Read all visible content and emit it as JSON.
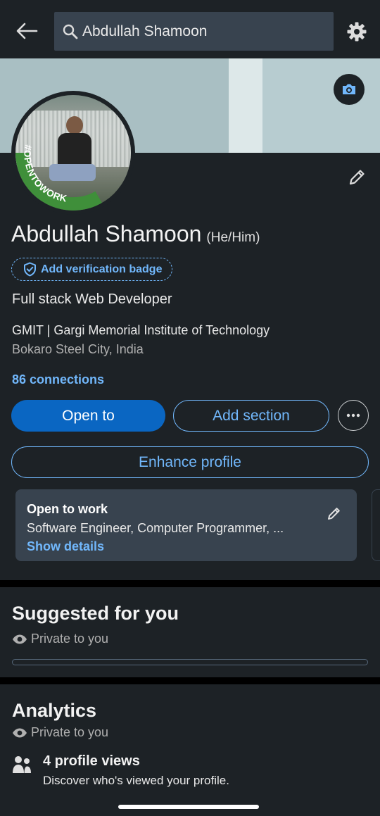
{
  "search": {
    "query": "Abdullah Shamoon"
  },
  "profile": {
    "name": "Abdullah Shamoon",
    "pronouns": "(He/Him)",
    "verification_label": "Add verification badge",
    "open_to_work_frame": "#OPENTOWORK",
    "headline": "Full stack Web Developer",
    "education": "GMIT | Gargi Memorial Institute of Technology",
    "location": "Bokaro Steel City, India",
    "connections": "86 connections"
  },
  "actions": {
    "open_to": "Open to",
    "add_section": "Add section",
    "enhance": "Enhance profile"
  },
  "open_to_work": {
    "title": "Open to work",
    "roles": "Software Engineer, Computer Programmer, ...",
    "show_details": "Show details"
  },
  "suggested": {
    "title": "Suggested for you",
    "visibility": "Private to you"
  },
  "analytics": {
    "title": "Analytics",
    "visibility": "Private to you",
    "profile_views": "4 profile views",
    "profile_views_desc": "Discover who's viewed your profile."
  },
  "colors": {
    "background": "#1d2226",
    "accent": "#71b7fb",
    "primary_button": "#0a66c2",
    "card": "#38434f",
    "open_to_work_green": "#3f8f3a"
  },
  "icons": {
    "back": "back-arrow-icon",
    "search": "search-icon",
    "settings": "gear-icon",
    "camera": "camera-icon",
    "edit": "pencil-icon",
    "verify": "shield-check-icon",
    "more": "ellipsis-icon",
    "private": "eye-icon",
    "views": "people-icon"
  }
}
